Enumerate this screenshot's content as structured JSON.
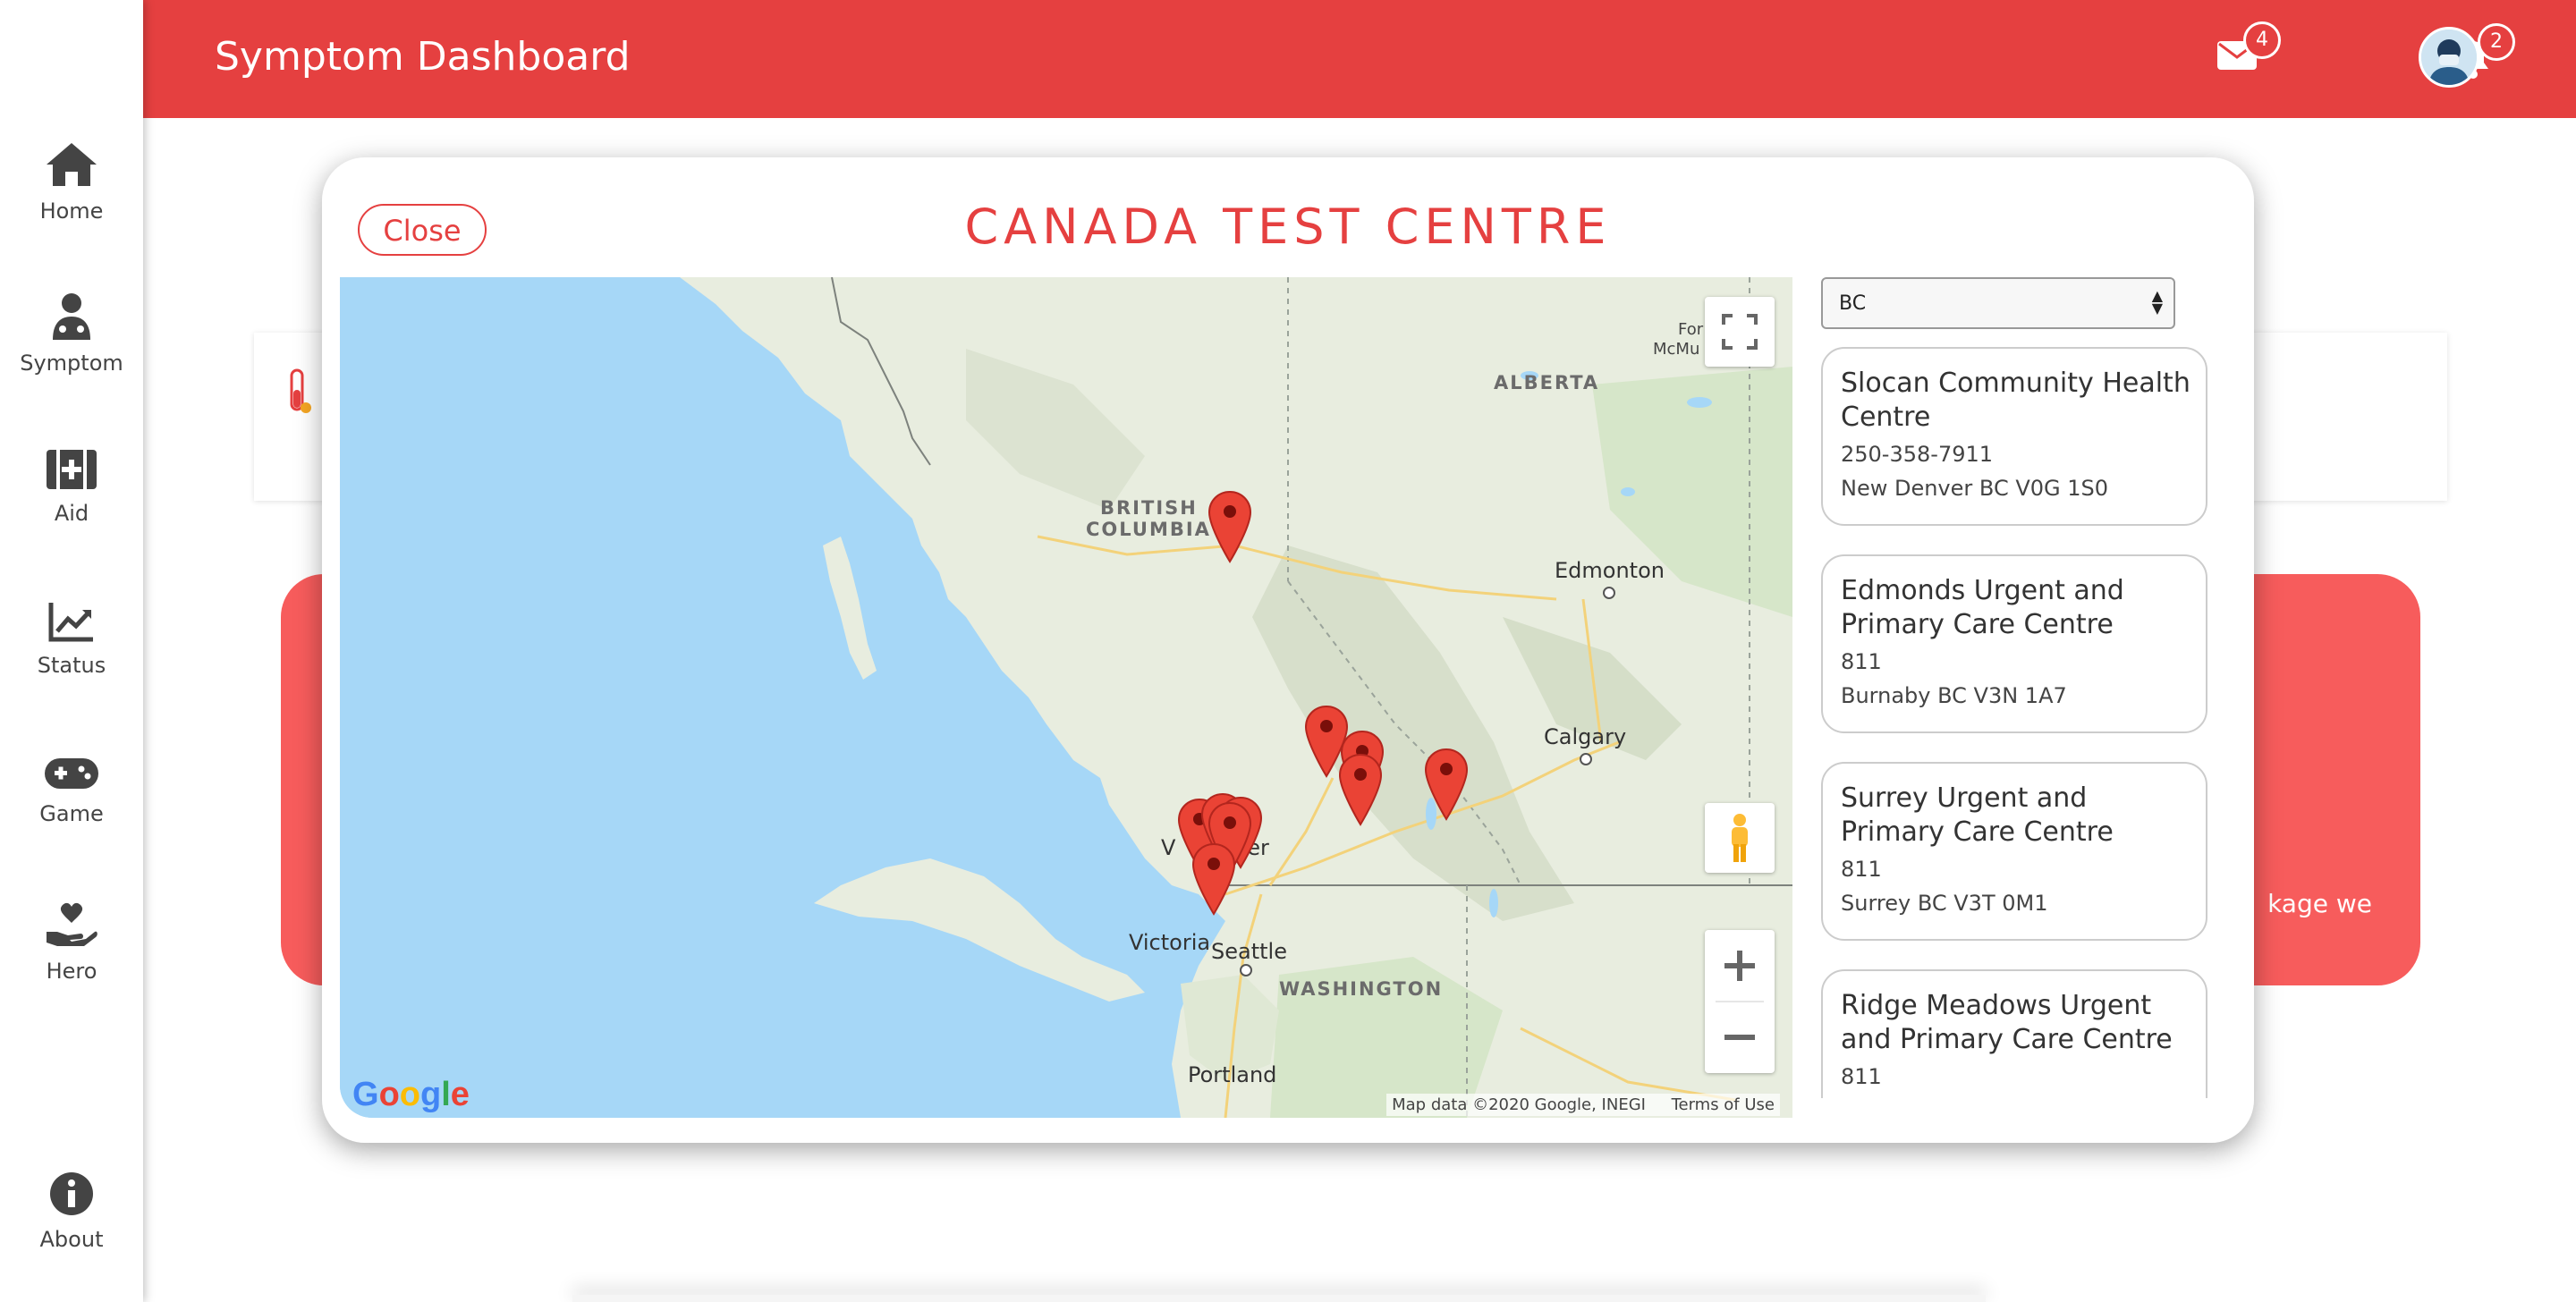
{
  "header": {
    "title": "Symptom Dashboard",
    "mail_count": "4",
    "notification_count": "2"
  },
  "sidebar": {
    "items": [
      {
        "label": "Home",
        "icon": "home-icon"
      },
      {
        "label": "Symptom",
        "icon": "doctor-icon"
      },
      {
        "label": "Aid",
        "icon": "first-aid-icon"
      },
      {
        "label": "Status",
        "icon": "chart-line-icon"
      },
      {
        "label": "Game",
        "icon": "gamepad-icon"
      },
      {
        "label": "Hero",
        "icon": "hand-heart-icon"
      },
      {
        "label": "About",
        "icon": "info-icon"
      }
    ]
  },
  "background": {
    "partial_text": "kage we"
  },
  "modal": {
    "close_label": "Close",
    "title": "CANADA TEST CENTRE",
    "province_select": {
      "value": "BC"
    },
    "centres": [
      {
        "name": "Slocan Community Health Centre",
        "phone": "250-358-7911",
        "address": "New Denver BC V0G 1S0"
      },
      {
        "name": "Edmonds Urgent and Primary Care Centre",
        "phone": "811",
        "address": "Burnaby BC V3N 1A7"
      },
      {
        "name": "Surrey Urgent and Primary Care Centre",
        "phone": "811",
        "address": "Surrey BC V3T 0M1"
      },
      {
        "name": "Ridge Meadows Urgent and Primary Care Centre",
        "phone": "811",
        "address": ""
      }
    ],
    "map": {
      "labels": {
        "alberta": "ALBERTA",
        "bc_line1": "BRITISH",
        "bc_line2": "COLUMBIA",
        "edmonton": "Edmonton",
        "calgary": "Calgary",
        "vancouver_partial": "V",
        "vancouver_partial2": "ver",
        "victoria": "Victoria",
        "seattle": "Seattle",
        "washington": "WASHINGTON",
        "portland": "Portland",
        "fort_mcmurray_1": "For",
        "fort_mcmurray_2": "McMu"
      },
      "google_logo": "Google",
      "attribution": "Map data ©2020 Google, INEGI",
      "terms": "Terms of Use"
    }
  },
  "colors": {
    "brand": "#e54040",
    "panel_red": "#f75c5c",
    "water": "#a6d7f7",
    "land": "#e8eddf"
  }
}
